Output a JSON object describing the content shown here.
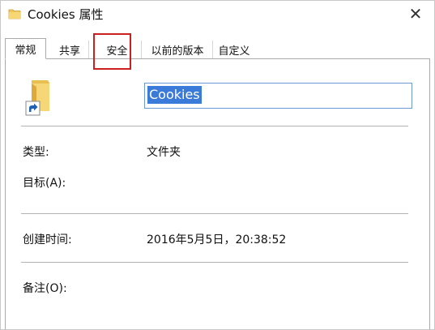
{
  "window": {
    "title": "Cookies 属性",
    "close_glyph": "✕",
    "folder_color": "#f0c75a"
  },
  "tabs": [
    {
      "label": "常规",
      "active": true
    },
    {
      "label": "共享",
      "active": false
    },
    {
      "label": "安全",
      "active": false
    },
    {
      "label": "以前的版本",
      "active": false
    },
    {
      "label": "自定义",
      "active": false
    }
  ],
  "highlight_color": "#cc1f1f",
  "general": {
    "name_value": "Cookies",
    "selection_color": "#3a7ad8",
    "type_label": "类型:",
    "type_value": "文件夹",
    "target_label": "目标(A):",
    "created_label": "创建时间:",
    "created_value": "2016年5月5日，20:38:52",
    "comment_label": "备注(O):"
  }
}
